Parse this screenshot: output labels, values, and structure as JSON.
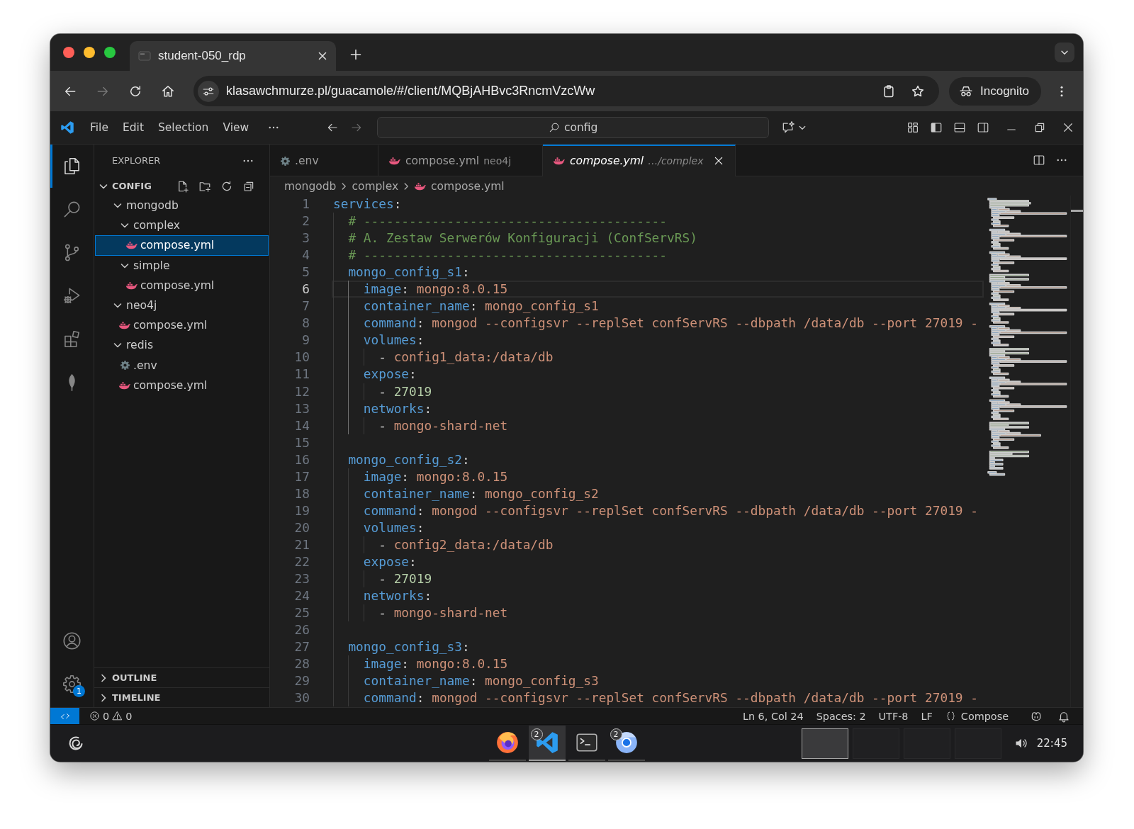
{
  "browser": {
    "tabs": [
      {
        "title": "student-050_rdp",
        "selected": true
      }
    ],
    "address": "klasawchmurze.pl/guacamole/#/client/MQBjAHBvc3RncmVzcWw",
    "profile": "Incognito"
  },
  "vscode": {
    "menu": [
      "File",
      "Edit",
      "Selection",
      "View"
    ],
    "command_center": "config",
    "activity_bar": {
      "items": [
        {
          "kind": "explorer",
          "selected": true
        },
        {
          "kind": "search",
          "selected": false
        },
        {
          "kind": "source-control",
          "selected": false
        },
        {
          "kind": "run",
          "selected": false
        },
        {
          "kind": "extensions",
          "selected": false
        },
        {
          "kind": "mongodb",
          "selected": false
        }
      ],
      "bottom": [
        {
          "kind": "account"
        },
        {
          "kind": "settings",
          "badge": "1"
        }
      ]
    },
    "sidebar": {
      "title": "EXPLORER",
      "sections": [
        {
          "title": "CONFIG",
          "expanded": true,
          "tree": [
            {
              "label": "mongodb",
              "kind": "folder",
              "expanded": true,
              "selected": false,
              "children": [
                {
                  "label": "complex",
                  "kind": "folder",
                  "expanded": true,
                  "selected": false,
                  "children": [
                    {
                      "label": "compose.yml",
                      "kind": "compose",
                      "selected": true
                    }
                  ]
                },
                {
                  "label": "simple",
                  "kind": "folder",
                  "expanded": true,
                  "selected": false,
                  "children": [
                    {
                      "label": "compose.yml",
                      "kind": "compose",
                      "selected": false
                    }
                  ]
                }
              ]
            },
            {
              "label": "neo4j",
              "kind": "folder",
              "expanded": true,
              "selected": false,
              "children": [
                {
                  "label": "compose.yml",
                  "kind": "compose",
                  "selected": false
                }
              ]
            },
            {
              "label": "redis",
              "kind": "folder",
              "expanded": true,
              "selected": false,
              "children": [
                {
                  "label": ".env",
                  "kind": "env",
                  "selected": false
                },
                {
                  "label": "compose.yml",
                  "kind": "compose",
                  "selected": false
                }
              ]
            }
          ]
        },
        {
          "title": "OUTLINE",
          "expanded": false
        },
        {
          "title": "TIMELINE",
          "expanded": false
        }
      ]
    },
    "editor": {
      "tabs": [
        {
          "label": ".env",
          "kind": "env",
          "selected": false,
          "preview": false
        },
        {
          "label": "compose.yml",
          "description": "neo4j",
          "kind": "compose",
          "selected": false,
          "preview": false
        },
        {
          "label": "compose.yml",
          "description": "…/complex",
          "kind": "compose",
          "selected": true,
          "preview": true
        }
      ],
      "breadcrumbs": [
        {
          "label": "mongodb",
          "kind": "folder"
        },
        {
          "label": "complex",
          "kind": "folder"
        },
        {
          "label": "compose.yml",
          "kind": "compose"
        }
      ],
      "lines": [
        {
          "number": "1",
          "current": false,
          "tokens": [
            {
              "kind": "key",
              "text": "services"
            },
            {
              "kind": "punct",
              "text": ":"
            }
          ],
          "children": [
            {
              "number": "2",
              "current": false,
              "tokens": [
                {
                  "kind": "comment",
                  "text": "# ----------------------------------------"
                }
              ]
            },
            {
              "number": "3",
              "current": false,
              "tokens": [
                {
                  "kind": "comment",
                  "text": "# A. Zestaw Serwerów Konfiguracji (ConfServRS)"
                }
              ]
            },
            {
              "number": "4",
              "current": false,
              "tokens": [
                {
                  "kind": "comment",
                  "text": "# ----------------------------------------"
                }
              ]
            },
            {
              "number": "5",
              "current": false,
              "tokens": [
                {
                  "kind": "key",
                  "text": "mongo_config_s1"
                },
                {
                  "kind": "punct",
                  "text": ":"
                }
              ],
              "children": [
                {
                  "number": "6",
                  "current": true,
                  "tokens": [
                    {
                      "kind": "key",
                      "text": "image"
                    },
                    {
                      "kind": "punct",
                      "text": ": "
                    },
                    {
                      "kind": "string",
                      "text": "mongo:8.0.15"
                    }
                  ]
                },
                {
                  "number": "7",
                  "current": false,
                  "tokens": [
                    {
                      "kind": "key",
                      "text": "container_name"
                    },
                    {
                      "kind": "punct",
                      "text": ": "
                    },
                    {
                      "kind": "string",
                      "text": "mongo_config_s1"
                    }
                  ]
                },
                {
                  "number": "8",
                  "current": false,
                  "tokens": [
                    {
                      "kind": "key",
                      "text": "command"
                    },
                    {
                      "kind": "punct",
                      "text": ": "
                    },
                    {
                      "kind": "string",
                      "text": "mongod --configsvr --replSet confServRS --dbpath /data/db --port 27019 -"
                    }
                  ]
                },
                {
                  "number": "9",
                  "current": false,
                  "tokens": [
                    {
                      "kind": "key",
                      "text": "volumes"
                    },
                    {
                      "kind": "punct",
                      "text": ":"
                    }
                  ],
                  "children": [
                    {
                      "number": "10",
                      "current": false,
                      "tokens": [
                        {
                          "kind": "punct",
                          "text": "- "
                        },
                        {
                          "kind": "string",
                          "text": "config1_data:/data/db"
                        }
                      ]
                    }
                  ]
                },
                {
                  "number": "11",
                  "current": false,
                  "tokens": [
                    {
                      "kind": "key",
                      "text": "expose"
                    },
                    {
                      "kind": "punct",
                      "text": ":"
                    }
                  ],
                  "children": [
                    {
                      "number": "12",
                      "current": false,
                      "tokens": [
                        {
                          "kind": "punct",
                          "text": "- "
                        },
                        {
                          "kind": "number",
                          "text": "27019"
                        }
                      ]
                    }
                  ]
                },
                {
                  "number": "13",
                  "current": false,
                  "tokens": [
                    {
                      "kind": "key",
                      "text": "networks"
                    },
                    {
                      "kind": "punct",
                      "text": ":"
                    }
                  ],
                  "children": [
                    {
                      "number": "14",
                      "current": false,
                      "tokens": [
                        {
                          "kind": "punct",
                          "text": "- "
                        },
                        {
                          "kind": "string",
                          "text": "mongo-shard-net"
                        }
                      ]
                    }
                  ]
                }
              ]
            },
            {
              "number": "15",
              "current": false
            },
            {
              "number": "16",
              "current": false,
              "tokens": [
                {
                  "kind": "key",
                  "text": "mongo_config_s2"
                },
                {
                  "kind": "punct",
                  "text": ":"
                }
              ],
              "children": [
                {
                  "number": "17",
                  "current": false,
                  "tokens": [
                    {
                      "kind": "key",
                      "text": "image"
                    },
                    {
                      "kind": "punct",
                      "text": ": "
                    },
                    {
                      "kind": "string",
                      "text": "mongo:8.0.15"
                    }
                  ]
                },
                {
                  "number": "18",
                  "current": false,
                  "tokens": [
                    {
                      "kind": "key",
                      "text": "container_name"
                    },
                    {
                      "kind": "punct",
                      "text": ": "
                    },
                    {
                      "kind": "string",
                      "text": "mongo_config_s2"
                    }
                  ]
                },
                {
                  "number": "19",
                  "current": false,
                  "tokens": [
                    {
                      "kind": "key",
                      "text": "command"
                    },
                    {
                      "kind": "punct",
                      "text": ": "
                    },
                    {
                      "kind": "string",
                      "text": "mongod --configsvr --replSet confServRS --dbpath /data/db --port 27019 -"
                    }
                  ]
                },
                {
                  "number": "20",
                  "current": false,
                  "tokens": [
                    {
                      "kind": "key",
                      "text": "volumes"
                    },
                    {
                      "kind": "punct",
                      "text": ":"
                    }
                  ],
                  "children": [
                    {
                      "number": "21",
                      "current": false,
                      "tokens": [
                        {
                          "kind": "punct",
                          "text": "- "
                        },
                        {
                          "kind": "string",
                          "text": "config2_data:/data/db"
                        }
                      ]
                    }
                  ]
                },
                {
                  "number": "22",
                  "current": false,
                  "tokens": [
                    {
                      "kind": "key",
                      "text": "expose"
                    },
                    {
                      "kind": "punct",
                      "text": ":"
                    }
                  ],
                  "children": [
                    {
                      "number": "23",
                      "current": false,
                      "tokens": [
                        {
                          "kind": "punct",
                          "text": "- "
                        },
                        {
                          "kind": "number",
                          "text": "27019"
                        }
                      ]
                    }
                  ]
                },
                {
                  "number": "24",
                  "current": false,
                  "tokens": [
                    {
                      "kind": "key",
                      "text": "networks"
                    },
                    {
                      "kind": "punct",
                      "text": ":"
                    }
                  ],
                  "children": [
                    {
                      "number": "25",
                      "current": false,
                      "tokens": [
                        {
                          "kind": "punct",
                          "text": "- "
                        },
                        {
                          "kind": "string",
                          "text": "mongo-shard-net"
                        }
                      ]
                    }
                  ]
                }
              ]
            },
            {
              "number": "26",
              "current": false
            },
            {
              "number": "27",
              "current": false,
              "tokens": [
                {
                  "kind": "key",
                  "text": "mongo_config_s3"
                },
                {
                  "kind": "punct",
                  "text": ":"
                }
              ],
              "children": [
                {
                  "number": "28",
                  "current": false,
                  "tokens": [
                    {
                      "kind": "key",
                      "text": "image"
                    },
                    {
                      "kind": "punct",
                      "text": ": "
                    },
                    {
                      "kind": "string",
                      "text": "mongo:8.0.15"
                    }
                  ]
                },
                {
                  "number": "29",
                  "current": false,
                  "tokens": [
                    {
                      "kind": "key",
                      "text": "container_name"
                    },
                    {
                      "kind": "punct",
                      "text": ": "
                    },
                    {
                      "kind": "string",
                      "text": "mongo_config_s3"
                    }
                  ]
                },
                {
                  "number": "30",
                  "current": false,
                  "tokens": [
                    {
                      "kind": "key",
                      "text": "command"
                    },
                    {
                      "kind": "punct",
                      "text": ": "
                    },
                    {
                      "kind": "string",
                      "text": "mongod --configsvr --replSet confServRS --dbpath /data/db --port 27019 -"
                    }
                  ]
                }
              ]
            }
          ]
        }
      ]
    },
    "status_bar": {
      "errors": "0",
      "warnings": "0",
      "items": [
        "Ln 6, Col 24",
        "Spaces: 2",
        "UTF-8",
        "LF"
      ],
      "language": "Compose"
    }
  },
  "taskbar": {
    "apps": [
      {
        "kind": "firefox",
        "selected": false
      },
      {
        "kind": "vscode",
        "badge": "2",
        "selected": true
      },
      {
        "kind": "terminal",
        "selected": false
      },
      {
        "kind": "chrome",
        "badge": "2",
        "selected": false
      }
    ],
    "desktops": [
      {
        "selected": true
      },
      {
        "selected": false
      },
      {
        "selected": false
      },
      {
        "selected": false
      }
    ],
    "time": "22:45"
  }
}
